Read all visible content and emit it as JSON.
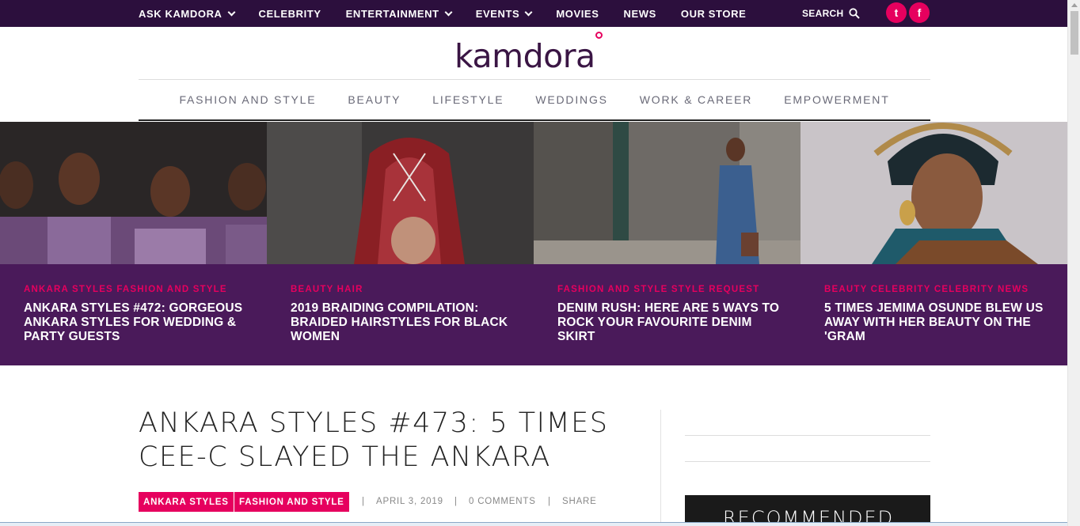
{
  "topnav": {
    "items": [
      {
        "label": "ASK KAMDORA",
        "dropdown": true
      },
      {
        "label": "CELEBRITY",
        "dropdown": false
      },
      {
        "label": "ENTERTAINMENT",
        "dropdown": true
      },
      {
        "label": "EVENTS",
        "dropdown": true
      },
      {
        "label": "MOVIES",
        "dropdown": false
      },
      {
        "label": "NEWS",
        "dropdown": false
      },
      {
        "label": "OUR STORE",
        "dropdown": false
      }
    ],
    "search_label": "SEARCH",
    "social": {
      "twitter_glyph": "t",
      "facebook_glyph": "f"
    }
  },
  "logo": {
    "text": "kamdora"
  },
  "category_nav": [
    "FASHION AND STYLE",
    "BEAUTY",
    "LIFESTYLE",
    "WEDDINGS",
    "WORK & CAREER",
    "EMPOWERMENT"
  ],
  "slider": [
    {
      "categories": "ANKARA STYLES  FASHION AND STYLE",
      "title": "ANKARA STYLES #472: GORGEOUS ANKARA STYLES FOR WEDDING & PARTY GUESTS"
    },
    {
      "categories": "BEAUTY  HAIR",
      "title": "2019 BRAIDING COMPILATION: BRAIDED HAIRSTYLES FOR BLACK WOMEN"
    },
    {
      "categories": "FASHION AND STYLE  STYLE REQUEST",
      "title": "DENIM RUSH: HERE ARE 5 WAYS TO ROCK YOUR FAVOURITE DENIM SKIRT"
    },
    {
      "categories": "BEAUTY  CELEBRITY  CELEBRITY NEWS",
      "title": "5 TIMES JEMIMA OSUNDE BLEW US AWAY WITH HER BEAUTY ON THE 'GRAM"
    }
  ],
  "article": {
    "title": "ANKARA STYLES #473: 5 TIMES CEE-C SLAYED THE ANKARA",
    "tags": [
      "ANKARA STYLES",
      "FASHION AND STYLE"
    ],
    "date": "APRIL 3, 2019",
    "comments": "0 COMMENTS",
    "share": "SHARE",
    "separator": "|"
  },
  "sidebar": {
    "recommended_label": "RECOMMENDED"
  },
  "colors": {
    "brand_purple": "#2c0f3d",
    "accent_pink": "#e6005e",
    "overlay_purple": "#4a1a5a"
  }
}
